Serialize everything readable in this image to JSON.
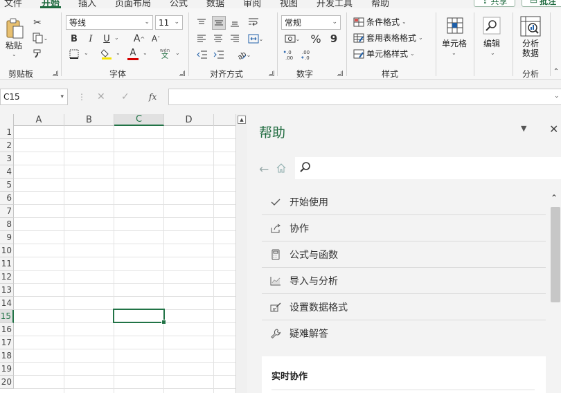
{
  "tabs": {
    "items": [
      "文件",
      "开始",
      "插入",
      "页面布局",
      "公式",
      "数据",
      "审阅",
      "视图",
      "开发工具",
      "帮助"
    ],
    "active": "开始",
    "share_label": "共享",
    "comment_label": "批注"
  },
  "ribbon": {
    "clipboard": {
      "paste_label": "粘贴",
      "group_label": "剪贴板"
    },
    "font": {
      "font_name": "等线",
      "font_size": "11",
      "bold": "B",
      "italic": "I",
      "underline": "U",
      "grow": "A",
      "shrink": "A",
      "font_color_glyph": "A",
      "phonetic_top": "wén",
      "phonetic_bottom": "文",
      "group_label": "字体"
    },
    "alignment": {
      "group_label": "对齐方式"
    },
    "number": {
      "format": "常规",
      "percent": "%",
      "comma": "9",
      "inc_decimal": "←.0 .00",
      "dec_decimal": ".00 →.0",
      "group_label": "数字"
    },
    "styles": {
      "conditional": "条件格式",
      "as_table": "套用表格格式",
      "cell_styles": "单元格样式",
      "group_label": "样式"
    },
    "cells": {
      "label": "单元格"
    },
    "editing": {
      "label": "编辑"
    },
    "analysis": {
      "label_line1": "分析",
      "label_line2": "数据",
      "group_label": "分析"
    }
  },
  "formula_bar": {
    "name_box": "C15",
    "fx": "fx",
    "value": ""
  },
  "grid": {
    "columns": [
      "A",
      "B",
      "C",
      "D"
    ],
    "rows": [
      "1",
      "2",
      "3",
      "4",
      "5",
      "6",
      "7",
      "8",
      "9",
      "10",
      "11",
      "12",
      "13",
      "14",
      "15",
      "16",
      "17",
      "18",
      "19",
      "20"
    ],
    "selected_column": "C",
    "selected_row": "15"
  },
  "help_pane": {
    "title": "帮助",
    "search_placeholder": "",
    "topics": [
      {
        "label": "开始使用",
        "icon": "check-icon"
      },
      {
        "label": "协作",
        "icon": "share-icon"
      },
      {
        "label": "公式与函数",
        "icon": "calculator-icon"
      },
      {
        "label": "导入与分析",
        "icon": "chart-icon"
      },
      {
        "label": "设置数据格式",
        "icon": "format-icon"
      },
      {
        "label": "疑难解答",
        "icon": "wrench-icon"
      }
    ],
    "card_title": "实时协作"
  },
  "colors": {
    "accent": "#217346",
    "title_green": "#1f6b3f"
  }
}
